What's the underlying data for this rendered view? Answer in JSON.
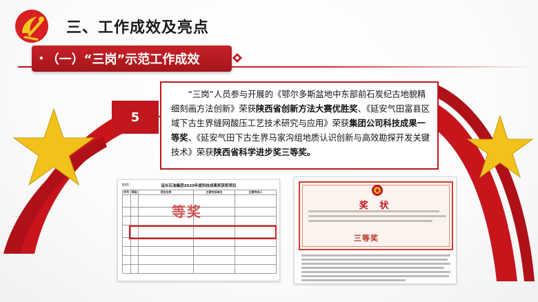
{
  "header": {
    "title": "三、工作成效及亮点",
    "emblem_icon": "party-emblem-icon"
  },
  "section": {
    "label": "（一）“三岗”示范工作成效",
    "bullet": "•",
    "accent_color": "#c0161d"
  },
  "item": {
    "number": "5",
    "text_parts": [
      {
        "t": "“三岗”人员参与开展的《鄂尔多斯盆地中东部前石炭纪古地貌精细刻画方法创新》荣获",
        "b": false
      },
      {
        "t": "陕西省创新方法大赛优胜奖",
        "b": true
      },
      {
        "t": "、《延安气田富县区域下古生界缝网酸压工艺技术研究与应用》荣获",
        "b": false
      },
      {
        "t": "集团公司科技成果一等奖",
        "b": true
      },
      {
        "t": "、《延安气田下古生界马家沟组地质认识创新与高效勘探开发关键技术》荣获",
        "b": false
      },
      {
        "t": "陕西省科学进步奖三等奖。",
        "b": true
      }
    ]
  },
  "document": {
    "attachment_label": "附件：",
    "title": "延长石油集团2020年度科技成果奖获奖项目",
    "columns": [
      "序号",
      "等级",
      "项目名称",
      "主要完成单位",
      "主要完成人"
    ],
    "stamp": "等奖"
  },
  "certificate": {
    "title": "奖 状",
    "prize": "三等奖",
    "emblem_icon": "national-emblem-icon"
  }
}
